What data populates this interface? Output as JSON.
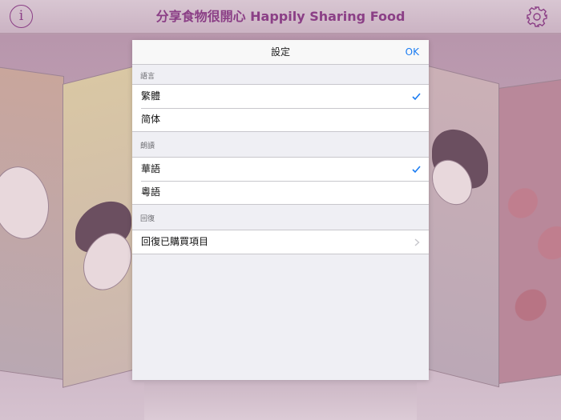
{
  "app": {
    "title": "分享食物很開心  Happily Sharing Food",
    "info_icon": "info-icon",
    "settings_icon": "gear-icon",
    "accent_color": "#8b3f86"
  },
  "settings": {
    "title": "設定",
    "ok_label": "OK",
    "accent_color": "#1a7cf2",
    "sections": {
      "language": {
        "header": "語言",
        "items": [
          {
            "label": "繁體",
            "selected": true
          },
          {
            "label": "简体",
            "selected": false
          }
        ]
      },
      "narration": {
        "header": "朗讀",
        "items": [
          {
            "label": "華語",
            "selected": true
          },
          {
            "label": "粵語",
            "selected": false
          }
        ]
      },
      "restore": {
        "header": "回復",
        "items": [
          {
            "label": "回復已購買項目",
            "icon": "chevron-right-icon"
          }
        ]
      }
    }
  }
}
